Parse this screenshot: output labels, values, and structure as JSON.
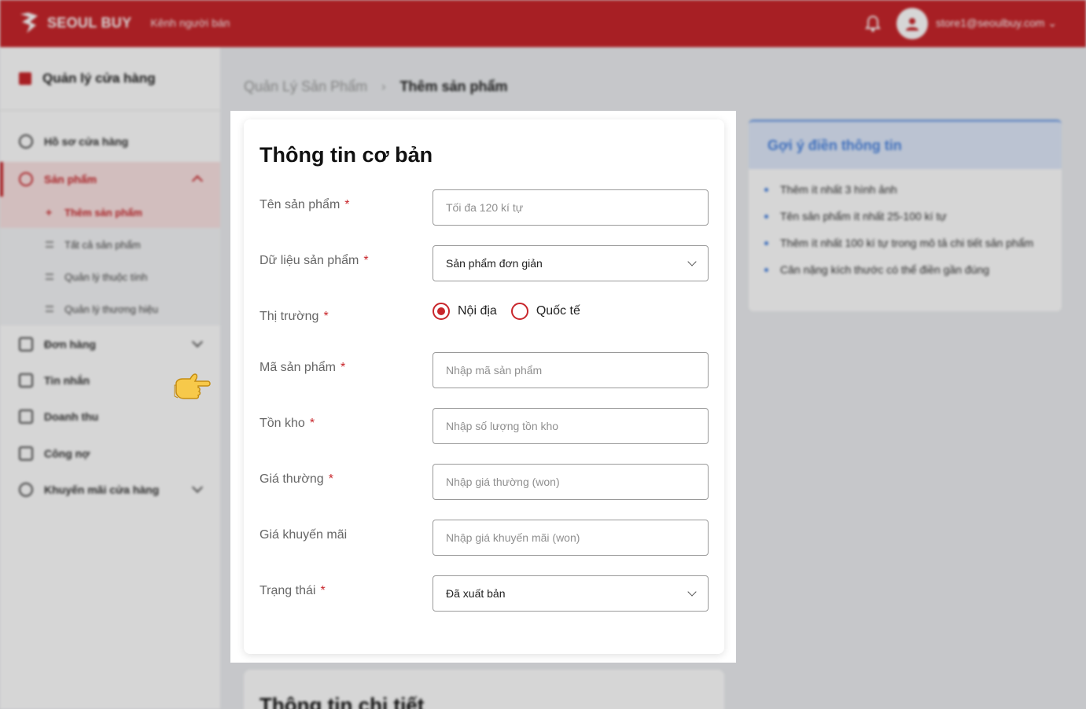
{
  "header": {
    "brand": "SEOUL BUY",
    "subtitle": "Kênh người bán",
    "user_email": "store1@seoulbuy.com"
  },
  "sidebar": {
    "store_title": "Quản lý cửa hàng",
    "items": [
      {
        "label": "Hồ sơ cửa hàng"
      },
      {
        "label": "Sản phẩm"
      },
      {
        "label": "Đơn hàng"
      },
      {
        "label": "Tin nhắn"
      },
      {
        "label": "Doanh thu"
      },
      {
        "label": "Công nợ"
      },
      {
        "label": "Khuyến mãi cửa hàng"
      }
    ],
    "product_sub": [
      {
        "label": "Thêm sản phẩm"
      },
      {
        "label": "Tất cả sản phẩm"
      },
      {
        "label": "Quản lý thuộc tính"
      },
      {
        "label": "Quản lý thương hiệu"
      }
    ]
  },
  "breadcrumb": {
    "parent": "Quản Lý Sản Phẩm",
    "current": "Thêm sản phẩm"
  },
  "form": {
    "title": "Thông tin cơ bản",
    "product_name": {
      "label": "Tên sản phẩm",
      "placeholder": "Tối đa 120 kí tự"
    },
    "product_data": {
      "label": "Dữ liệu sản phẩm",
      "value": "Sản phẩm đơn giản"
    },
    "market": {
      "label": "Thị trường",
      "option_domestic": "Nội địa",
      "option_international": "Quốc tế",
      "selected": "Nội địa"
    },
    "sku": {
      "label": "Mã sản phẩm",
      "placeholder": "Nhập mã sản phẩm"
    },
    "stock": {
      "label": "Tồn kho",
      "placeholder": "Nhập số lượng tồn kho"
    },
    "regular_price": {
      "label": "Giá thường",
      "placeholder": "Nhập giá thường (won)"
    },
    "sale_price": {
      "label": "Giá khuyến mãi",
      "placeholder": "Nhập giá khuyến mãi (won)"
    },
    "status": {
      "label": "Trạng thái",
      "value": "Đã xuất bản"
    },
    "required_mark": "*"
  },
  "tips": {
    "title": "Gợi ý điền thông tin",
    "items": [
      "Thêm ít nhất 3 hình ảnh",
      "Tên sản phẩm ít nhất 25-100 kí tự",
      "Thêm ít nhất 100 kí tự trong mô tả chi tiết sản phẩm",
      "Cân nặng kích thước có thể điền gần đúng"
    ]
  },
  "detail_card": {
    "title": "Thông tin chi tiết"
  },
  "colors": {
    "brand_red": "#c8262b",
    "tip_blue": "#4a84e0"
  }
}
